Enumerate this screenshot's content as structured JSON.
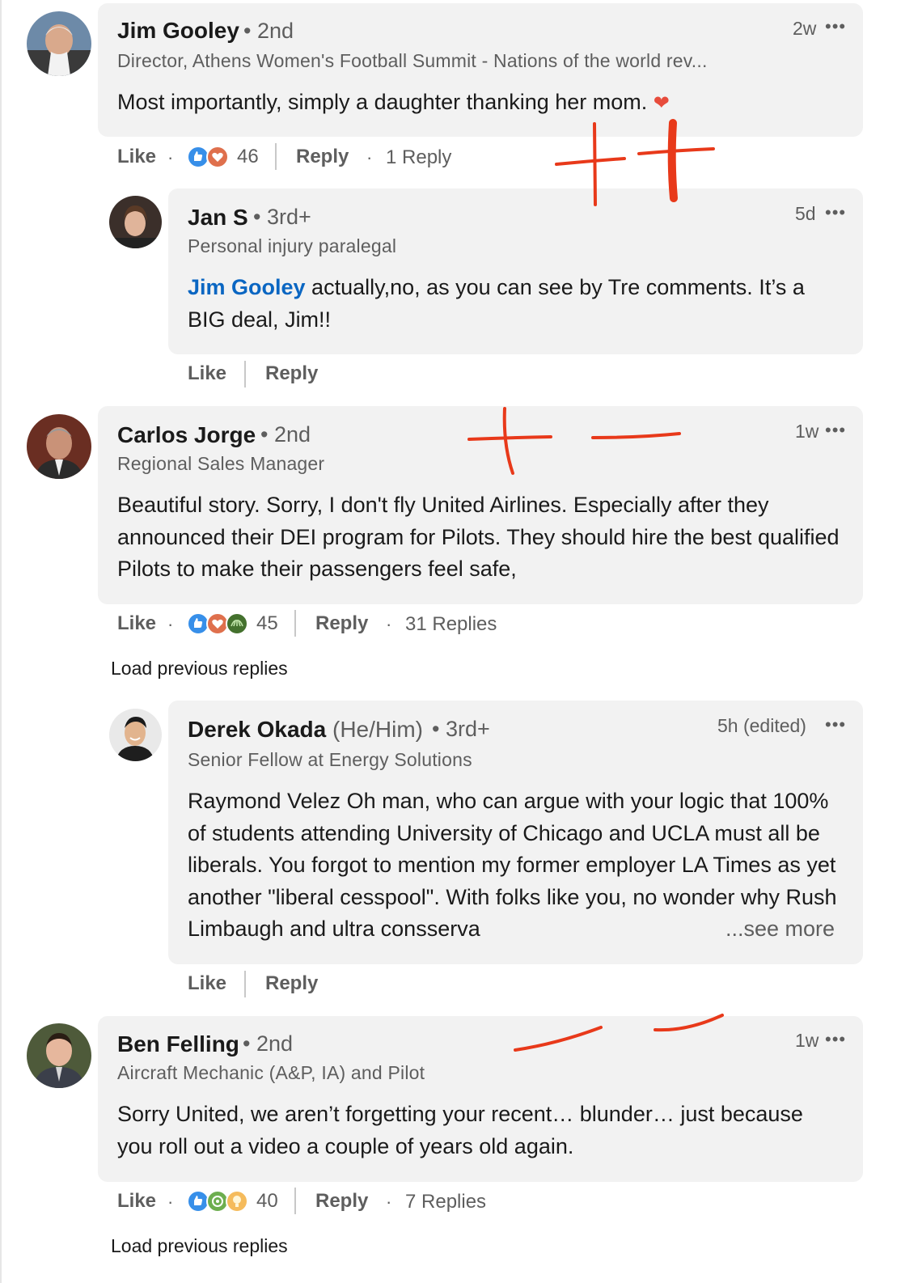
{
  "comments": [
    {
      "name": "Jim Gooley",
      "degree": "• 2nd",
      "headline": "Director, Athens Women's Football Summit - Nations of the world rev...",
      "time": "2w",
      "text": "Most importantly, simply a daughter thanking her mom.",
      "emoji": "❤️",
      "like_label": "Like",
      "reaction_count": "46",
      "reply_label": "Reply",
      "replies_label": "1 Reply",
      "reactions": [
        "like-icon",
        "love-icon"
      ]
    },
    {
      "name": "Carlos Jorge",
      "degree": "• 2nd",
      "headline": "Regional Sales Manager",
      "time": "1w",
      "text": "Beautiful story. Sorry, I don't fly United Airlines. Especially after they announced their DEI program for Pilots. They should hire the best qualified Pilots to make their passengers feel safe,",
      "like_label": "Like",
      "reaction_count": "45",
      "reply_label": "Reply",
      "replies_label": "31 Replies",
      "reactions": [
        "like-icon",
        "love-icon",
        "support-icon"
      ],
      "load_previous": "Load previous replies"
    },
    {
      "name": "Ben Felling",
      "degree": "• 2nd",
      "headline": "Aircraft Mechanic (A&P, IA) and Pilot",
      "time": "1w",
      "text": "Sorry United, we aren’t forgetting your recent… blunder… just because you roll out a video a couple of years old again.",
      "like_label": "Like",
      "reaction_count": "40",
      "reply_label": "Reply",
      "replies_label": "7 Replies",
      "reactions": [
        "like-icon",
        "celebrate-icon",
        "insightful-icon"
      ],
      "load_previous": "Load previous replies"
    }
  ],
  "replies": [
    {
      "name": "Jan S",
      "degree": "• 3rd+",
      "headline": "Personal injury paralegal",
      "time": "5d",
      "mention": "Jim Gooley",
      "text": " actually,no, as you can see by Tre comments. It’s a BIG deal, Jim!!",
      "like_label": "Like",
      "reply_label": "Reply"
    },
    {
      "name": "Derek Okada",
      "pronouns": "(He/Him)",
      "degree": "• 3rd+",
      "headline": "Senior Fellow at Energy Solutions",
      "time": "5h (edited)",
      "text": "Raymond Velez Oh man, who can argue with your logic that 100% of students attending University of Chicago and UCLA must all be liberals. You forgot to mention my former employer LA Times as yet another \"liberal cesspool\". With folks like you, no wonder why Rush Limbaugh and ultra consserva",
      "see_more": "...see more",
      "like_label": "Like",
      "reply_label": "Reply"
    }
  ],
  "more_icon": "more-options-icon",
  "colors": {
    "bubble": "#f2f2f2",
    "mention": "#0a66c2",
    "annotation": "#e8391a",
    "muted": "#5e5e5e"
  }
}
